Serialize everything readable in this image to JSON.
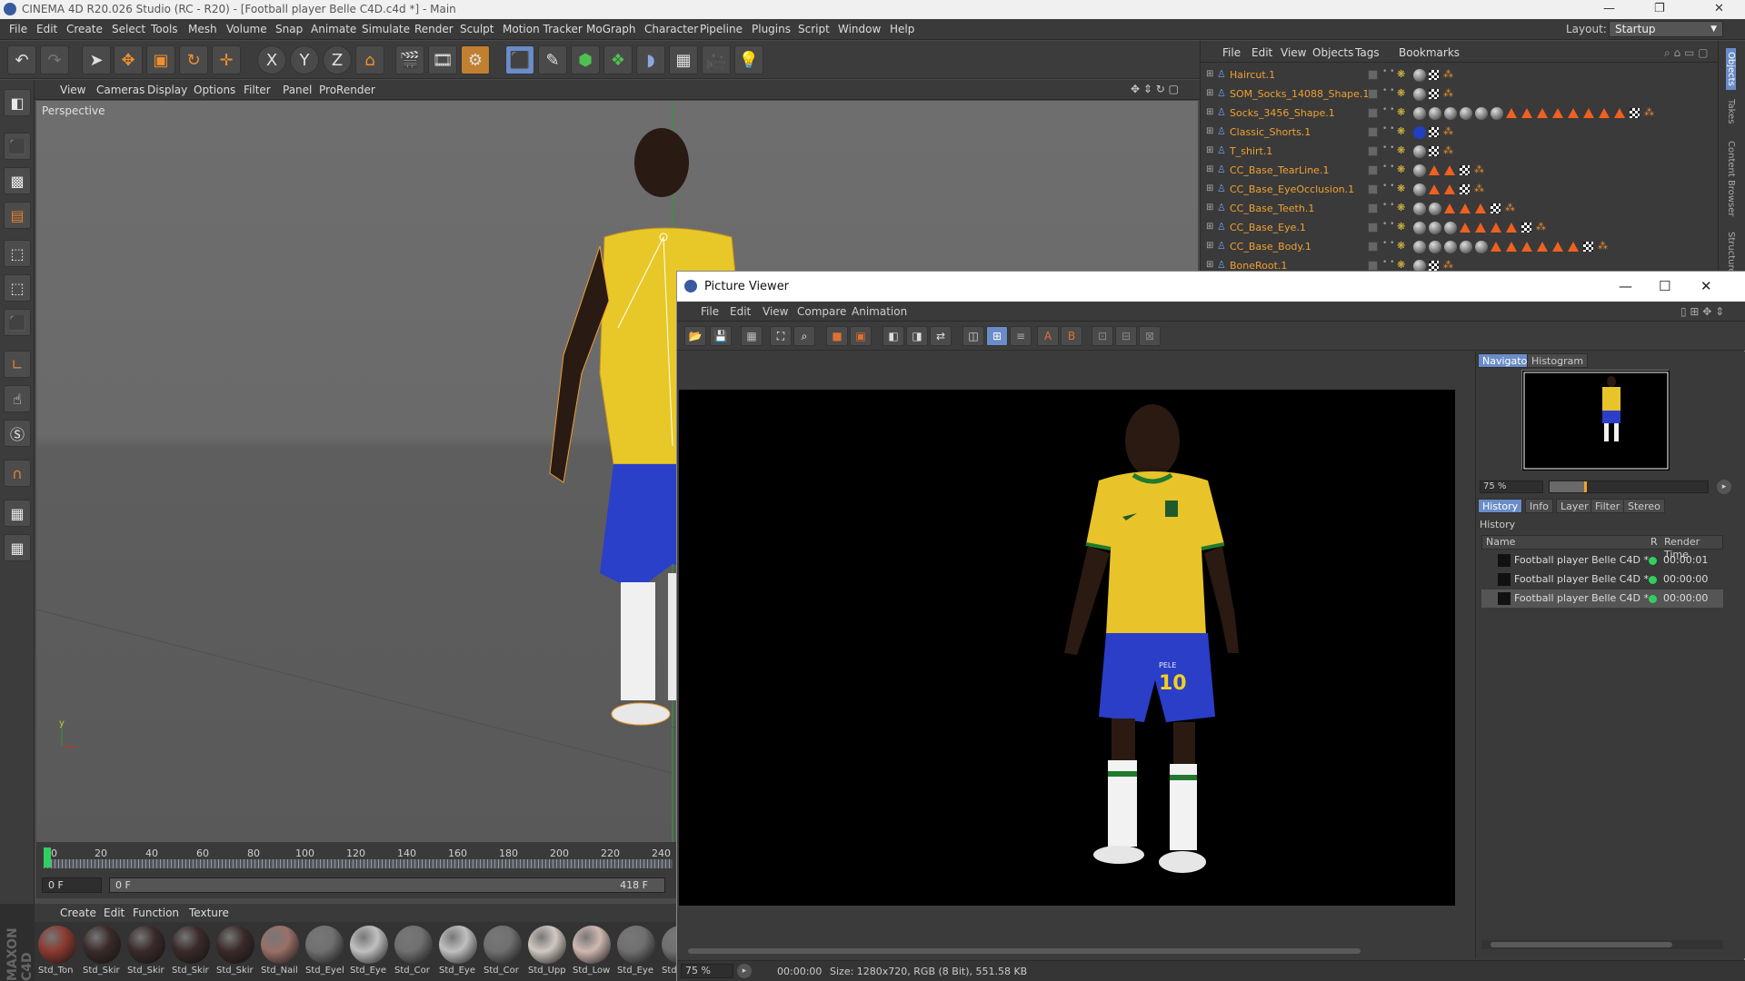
{
  "window": {
    "title": "CINEMA 4D R20.026 Studio (RC - R20) - [Football player Belle C4D.c4d *] - Main",
    "controls": [
      "—",
      "❐",
      "✕"
    ]
  },
  "menubar": {
    "items": [
      "File",
      "Edit",
      "Create",
      "Select",
      "Tools",
      "Mesh",
      "Volume",
      "Snap",
      "Animate",
      "Simulate",
      "Render",
      "Sculpt",
      "Motion Tracker",
      "MoGraph",
      "Character",
      "Pipeline",
      "Plugins",
      "Script",
      "Window",
      "Help"
    ],
    "layout_label": "Layout:",
    "layout_value": "Startup"
  },
  "toolbar": {
    "axis_labels": [
      "X",
      "Y",
      "Z"
    ]
  },
  "viewport": {
    "menu": [
      "View",
      "Cameras",
      "Display",
      "Options",
      "Filter",
      "Panel",
      "ProRender"
    ],
    "label": "Perspective"
  },
  "timeline": {
    "ticks": [
      "0",
      "20",
      "40",
      "60",
      "80",
      "100",
      "120",
      "140",
      "160",
      "180",
      "200",
      "220",
      "240"
    ],
    "current_frame": "0 F",
    "range_start": "0 F",
    "range_end": "418 F"
  },
  "materials": {
    "menu": [
      "Create",
      "Edit",
      "Function",
      "Texture"
    ],
    "items": [
      {
        "label": "Std_Ton",
        "color": "#8a3a30"
      },
      {
        "label": "Std_Skir",
        "color": "#3a2a2a"
      },
      {
        "label": "Std_Skir",
        "color": "#3a2a2a"
      },
      {
        "label": "Std_Skir",
        "color": "#3a2a2a"
      },
      {
        "label": "Std_Skir",
        "color": "#3a2a2a"
      },
      {
        "label": "Std_Nail",
        "color": "#9a7068"
      },
      {
        "label": "Std_Eyel",
        "color": "#707070"
      },
      {
        "label": "Std_Eye",
        "color": "#c0c0c0"
      },
      {
        "label": "Std_Cor",
        "color": "#707070"
      },
      {
        "label": "Std_Eye",
        "color": "#c0c0c0"
      },
      {
        "label": "Std_Cor",
        "color": "#707070"
      },
      {
        "label": "Std_Upp",
        "color": "#d0c8c0"
      },
      {
        "label": "Std_Low",
        "color": "#d0b8b0"
      },
      {
        "label": "Std_Eye",
        "color": "#707070"
      },
      {
        "label": "Std",
        "color": "#707070"
      }
    ]
  },
  "objects": {
    "menu": [
      "File",
      "Edit",
      "View",
      "Objects",
      "Tags",
      "Bookmarks"
    ],
    "rows": [
      {
        "name": "Haircut.1",
        "tri": 0,
        "balls": 0
      },
      {
        "name": "SOM_Socks_14088_Shape.1",
        "tri": 0,
        "balls": 0
      },
      {
        "name": "Socks_3456_Shape.1",
        "tri": 8,
        "balls": 6
      },
      {
        "name": "Classic_Shorts.1",
        "tri": 0,
        "balls": 1
      },
      {
        "name": "T_shirt.1",
        "tri": 0,
        "balls": 0
      },
      {
        "name": "CC_Base_TearLine.1",
        "tri": 2,
        "balls": 0
      },
      {
        "name": "CC_Base_EyeOcclusion.1",
        "tri": 2,
        "balls": 0
      },
      {
        "name": "CC_Base_Teeth.1",
        "tri": 3,
        "balls": 2
      },
      {
        "name": "CC_Base_Eye.1",
        "tri": 4,
        "balls": 3
      },
      {
        "name": "CC_Base_Body.1",
        "tri": 6,
        "balls": 5
      },
      {
        "name": "BoneRoot.1",
        "tri": 0,
        "balls": 0
      }
    ]
  },
  "right_strip": [
    "Objects",
    "Takes",
    "Content Browser",
    "Structure"
  ],
  "picture_viewer": {
    "title": "Picture Viewer",
    "controls": [
      "—",
      "☐",
      "✕"
    ],
    "menu": [
      "File",
      "Edit",
      "View",
      "Compare",
      "Animation"
    ],
    "navigator_tab": "Navigator",
    "histogram_tab": "Histogram",
    "nav_zoom": "75 %",
    "tabs": [
      "History",
      "Info",
      "Layer",
      "Filter",
      "Stereo"
    ],
    "history_label": "History",
    "columns": {
      "name": "Name",
      "r": "R",
      "time": "Render Time"
    },
    "history": [
      {
        "name": "Football player Belle C4D *",
        "time": "00:00:01"
      },
      {
        "name": "Football player Belle C4D *",
        "time": "00:00:00"
      },
      {
        "name": "Football player Belle C4D *",
        "time": "00:00:00"
      }
    ],
    "status": {
      "zoom": "75 %",
      "time": "00:00:00",
      "info": "Size: 1280x720, RGB (8 Bit), 551.58 KB"
    },
    "jersey_number": "10",
    "jersey_name": "PELE"
  },
  "colors": {
    "accent_blue": "#6a8cc8",
    "object_name": "#f0a030",
    "status_green": "#30d060"
  }
}
